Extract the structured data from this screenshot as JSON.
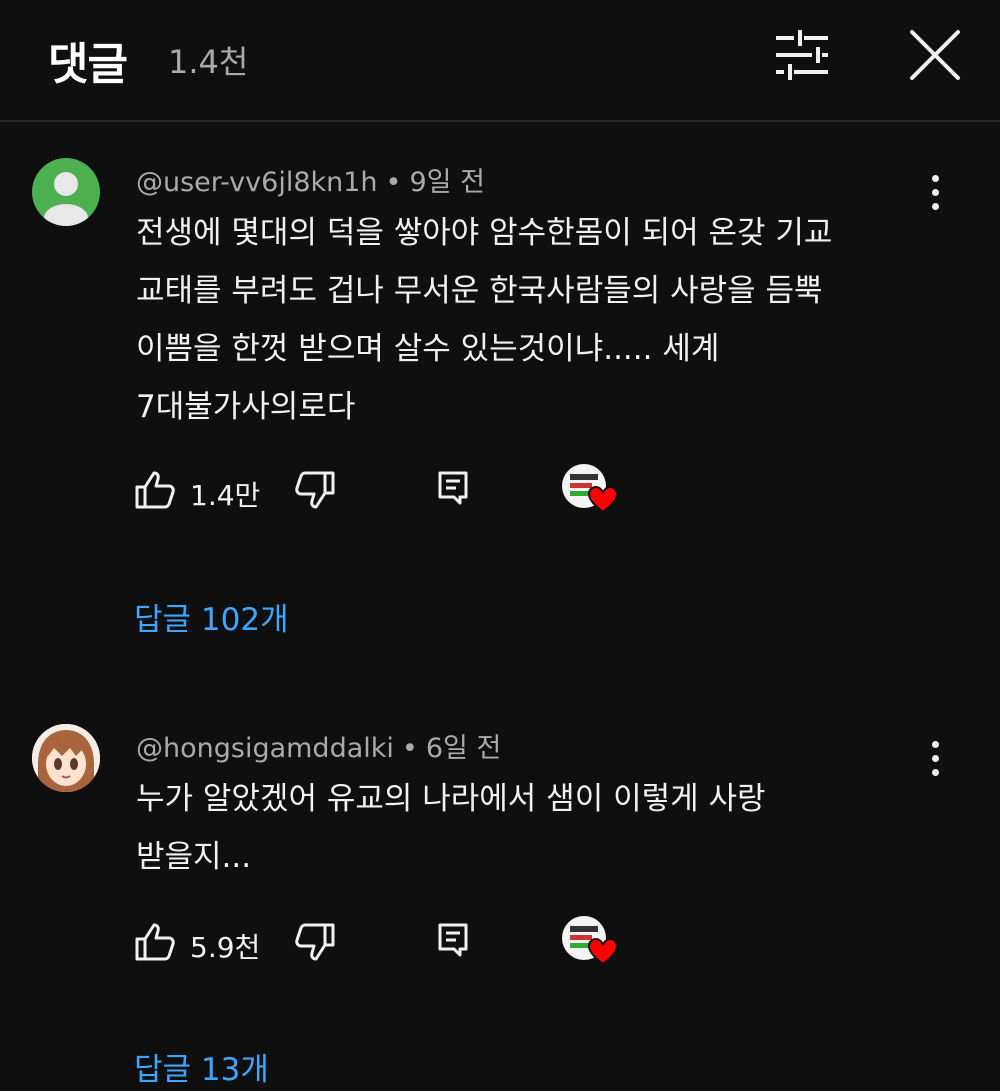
{
  "header": {
    "title": "댓글",
    "count": "1.4천"
  },
  "comments": [
    {
      "author": "@user-vv6jl8kn1h",
      "time": "9일 전",
      "text": "전생에 몇대의 덕을 쌓아야  암수한몸이 되어  온갖 기교\n교태를 부려도 겁나 무서운 한국사람들의 사랑을 듬뿍\n이쁨을 한껏 받으며 살수 있는것이냐..... 세계\n7대불가사의로다",
      "likes": "1.4만",
      "replies": "답글 102개",
      "avatar_color": "#4caf50"
    },
    {
      "author": "@hongsigamddalki",
      "time": "6일 전",
      "text": "누가 알았겠어 유교의 나라에서 샘이 이렇게 사랑\n받을지...",
      "likes": "5.9천",
      "replies": "답글 13개",
      "avatar_color": "#c98a5c"
    }
  ],
  "icons": {
    "filter": "sliders-icon",
    "close": "close-icon",
    "menu": "more-vertical-icon",
    "like": "thumbs-up-icon",
    "dislike": "thumbs-down-icon",
    "reply": "reply-icon",
    "creator_heart": "creator-heart-icon"
  },
  "colors": {
    "background": "#0f0f0f",
    "text": "#f1f1f1",
    "secondary_text": "#aaaaaa",
    "link": "#3ea6ff",
    "heart": "#ff0000"
  }
}
